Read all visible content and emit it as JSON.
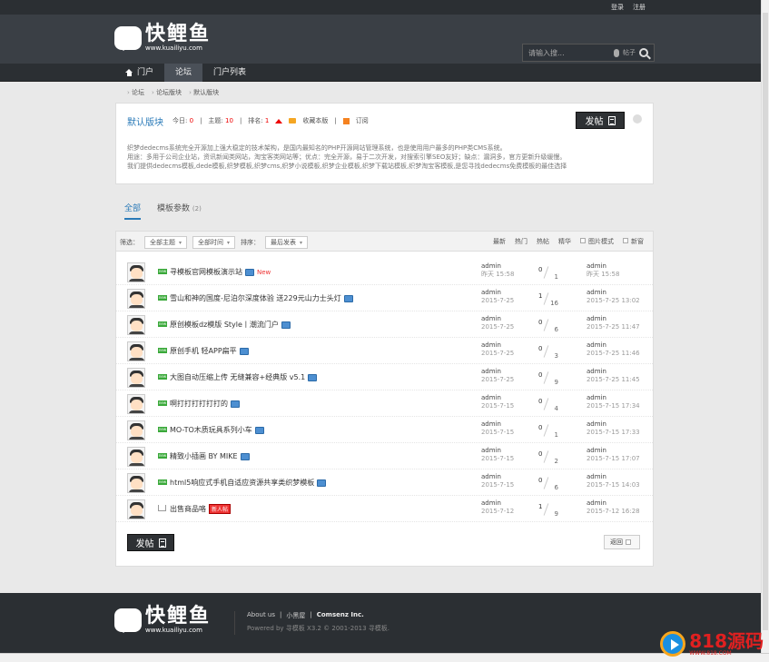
{
  "topbar": {
    "login": "登录",
    "register": "注册"
  },
  "brand": {
    "name": "快鲤鱼",
    "url": "www.kuailiyu.com"
  },
  "search": {
    "placeholder": "请输入搜...",
    "category": "帖子"
  },
  "nav": {
    "items": [
      "门户",
      "论坛",
      "门户列表"
    ]
  },
  "breadcrumb": [
    "论坛",
    "论坛版块",
    "默认版块"
  ],
  "forum": {
    "title": "默认版块",
    "today_label": "今日:",
    "today": "0",
    "topics_label": "主题:",
    "topics": "10",
    "rank_label": "排名:",
    "rank": "1",
    "favorite": "收藏本版",
    "subscribe": "订阅",
    "post_button": "发帖",
    "desc": [
      "织梦dedecms系统完全开源加上强大稳定的技术架构，是国内最知名的PHP开源网站管理系统，也是使用用户最多的PHP类CMS系统。",
      "用途：多用于公司企业站，资讯新闻类网站，淘宝客类网站等；优点：完全开源，易于二次开发，对搜索引擎SEO友好；缺点：漏洞多，官方更新升级缓慢。",
      "我们提供dedecms模板,dede模板,织梦模板,织梦cms,织梦小说模板,织梦企业模板,织梦下载站模板,织梦淘宝客模板,是您寻找dedecms免费模板的最佳选择"
    ]
  },
  "tabs": [
    {
      "label": "全部",
      "count": ""
    },
    {
      "label": "模板参数",
      "count": "(2)"
    }
  ],
  "filter": {
    "label": "筛选：",
    "type": "全部主题",
    "time": "全部时间",
    "sort_label": "排序：",
    "sort": "最后发表",
    "right": [
      "最新",
      "热门",
      "热帖",
      "精华"
    ],
    "pic_mode": "图片模式",
    "new_window": "新窗"
  },
  "threads": [
    {
      "title": "寻模板官网模板演示站",
      "img": true,
      "tag": "New",
      "tag_type": "new",
      "author": "admin",
      "date": "昨天 15:58",
      "replies": "0",
      "views": "1",
      "last_user": "admin",
      "last_date": "昨天 15:58",
      "icon": "new"
    },
    {
      "title": "雪山和神的国度-尼泊尔深度体验 送229元山力士头灯",
      "img": true,
      "tag": "",
      "author": "admin",
      "date": "2015-7-25",
      "replies": "1",
      "views": "16",
      "last_user": "admin",
      "last_date": "2015-7-25 13:02",
      "icon": "new"
    },
    {
      "title": "原创模板dz模版 Style丨潮流门户",
      "img": true,
      "tag": "",
      "author": "admin",
      "date": "2015-7-25",
      "replies": "0",
      "views": "6",
      "last_user": "admin",
      "last_date": "2015-7-25 11:47",
      "icon": "new"
    },
    {
      "title": "原创手机 轻APP扁平",
      "img": true,
      "tag": "",
      "author": "admin",
      "date": "2015-7-25",
      "replies": "0",
      "views": "3",
      "last_user": "admin",
      "last_date": "2015-7-25 11:46",
      "icon": "new"
    },
    {
      "title": "大图自动压缩上传 无缝兼容+经典版 v5.1",
      "img": true,
      "tag": "",
      "author": "admin",
      "date": "2015-7-25",
      "replies": "0",
      "views": "9",
      "last_user": "admin",
      "last_date": "2015-7-25 11:45",
      "icon": "new"
    },
    {
      "title": "啊打打打打打打的",
      "img": true,
      "tag": "",
      "author": "admin",
      "date": "2015-7-15",
      "replies": "0",
      "views": "4",
      "last_user": "admin",
      "last_date": "2015-7-15 17:34",
      "icon": "new"
    },
    {
      "title": "MO-TO木质玩具系列小车",
      "img": true,
      "tag": "",
      "author": "admin",
      "date": "2015-7-15",
      "replies": "0",
      "views": "1",
      "last_user": "admin",
      "last_date": "2015-7-15 17:33",
      "icon": "new"
    },
    {
      "title": "精致小插画 BY MIKE",
      "img": true,
      "tag": "",
      "author": "admin",
      "date": "2015-7-15",
      "replies": "0",
      "views": "2",
      "last_user": "admin",
      "last_date": "2015-7-15 17:07",
      "icon": "new"
    },
    {
      "title": "html5响应式手机自适应资源共享类织梦模板",
      "img": true,
      "tag": "",
      "author": "admin",
      "date": "2015-7-15",
      "replies": "0",
      "views": "6",
      "last_user": "admin",
      "last_date": "2015-7-15 14:03",
      "icon": "new"
    },
    {
      "title": "出售商品咯",
      "img": false,
      "tag": "新人帖",
      "tag_type": "badge",
      "author": "admin",
      "date": "2015-7-12",
      "replies": "1",
      "views": "9",
      "last_user": "admin",
      "last_date": "2015-7-12 16:28",
      "icon": "cart"
    }
  ],
  "list_bottom": {
    "post_button": "发帖",
    "back": "返回"
  },
  "footer": {
    "about": "About us",
    "sep": "|",
    "blackroom": "小黑屋",
    "company": "Comsenz Inc.",
    "powered": "Powered by 寻模板 X3.2 © 2001-2013 寻模板."
  },
  "watermark": {
    "text": "818源码",
    "sub": "WWW.818.COM"
  }
}
